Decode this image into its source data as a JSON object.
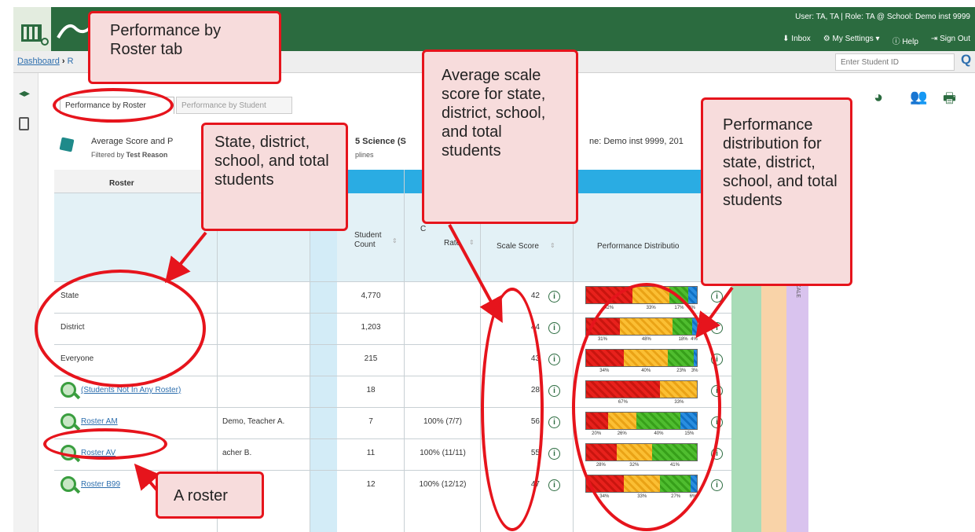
{
  "header": {
    "user_info": "User: TA, TA  |  Role: TA @ School: Demo inst 9999",
    "links": [
      "⬇ Inbox",
      "⚙ My Settings ▾",
      "ⓘ Help",
      "⇥ Sign Out"
    ]
  },
  "breadcrumb": {
    "root": "Dashboard",
    "separator": " ›",
    "rest": " R"
  },
  "search": {
    "placeholder": "Enter Student ID"
  },
  "tabs": {
    "by_roster": "Performance by Roster",
    "by_student": "Performance by Student"
  },
  "summary": {
    "title": "Average Score and P",
    "title2": "5 Science (S",
    "title3": "ne: Demo inst 9999, 201",
    "filter_prefix": "Filtered by ",
    "filter_bold": "Test Reason",
    "filter2": "plines"
  },
  "table": {
    "roster_header": "Roster",
    "student_count_header": "Student Count",
    "completion_header_a": "C",
    "completion_header_b": "Rate",
    "scale_header": "Scale Score",
    "perf_header": "Performance Distributio",
    "ribbon_text": "SCALE",
    "rows": [
      {
        "name": "State",
        "teacher": "",
        "count": "4,770",
        "rate": "",
        "score": "42",
        "dist": [
          42,
          33,
          17,
          8
        ],
        "labels": [
          "42%",
          "33%",
          "17%",
          "8%"
        ],
        "link": false
      },
      {
        "name": "District",
        "teacher": "",
        "count": "1,203",
        "rate": "",
        "score": "44",
        "dist": [
          31,
          48,
          18,
          4
        ],
        "labels": [
          "31%",
          "48%",
          "18%",
          "4%"
        ],
        "link": false
      },
      {
        "name": "Everyone",
        "teacher": "",
        "count": "215",
        "rate": "",
        "score": "43",
        "dist": [
          34,
          40,
          23,
          3
        ],
        "labels": [
          "34%",
          "40%",
          "23%",
          "3%"
        ],
        "link": false
      },
      {
        "name": "(Students Not In Any Roster)",
        "teacher": "",
        "count": "18",
        "rate": "",
        "score": "28",
        "dist": [
          67,
          33,
          0,
          0
        ],
        "labels": [
          "67%",
          "33%",
          "",
          ""
        ],
        "link": true
      },
      {
        "name": "Roster AM",
        "teacher": "Demo, Teacher A.",
        "count": "7",
        "rate": "100% (7/7)",
        "score": "56",
        "dist": [
          20,
          26,
          40,
          15
        ],
        "labels": [
          "20%",
          "26%",
          "40%",
          "15%"
        ],
        "link": true
      },
      {
        "name": "Roster AV",
        "teacher": "acher B.",
        "count": "11",
        "rate": "100% (11/11)",
        "score": "55",
        "dist": [
          28,
          32,
          41,
          0
        ],
        "labels": [
          "28%",
          "32%",
          "41%",
          ""
        ],
        "link": true
      },
      {
        "name": "Roster B99",
        "teacher": "acher C.",
        "count": "12",
        "rate": "100% (12/12)",
        "score": "47",
        "dist": [
          34,
          33,
          27,
          6
        ],
        "labels": [
          "34%",
          "33%",
          "27%",
          "6%"
        ],
        "link": true
      }
    ]
  },
  "callouts": {
    "tab": "Performance by Roster tab",
    "state": "State, district, school, and total students",
    "avg": "Average scale score for state, district, school, and total students",
    "perf": "Performance distribution for state, district, school, and total students",
    "roster": "A roster"
  },
  "colors": {
    "header_green": "#2b6b3f",
    "table_blue": "#2aace3",
    "callout_red": "#e6141c",
    "callout_fill": "#f7dcdc"
  }
}
